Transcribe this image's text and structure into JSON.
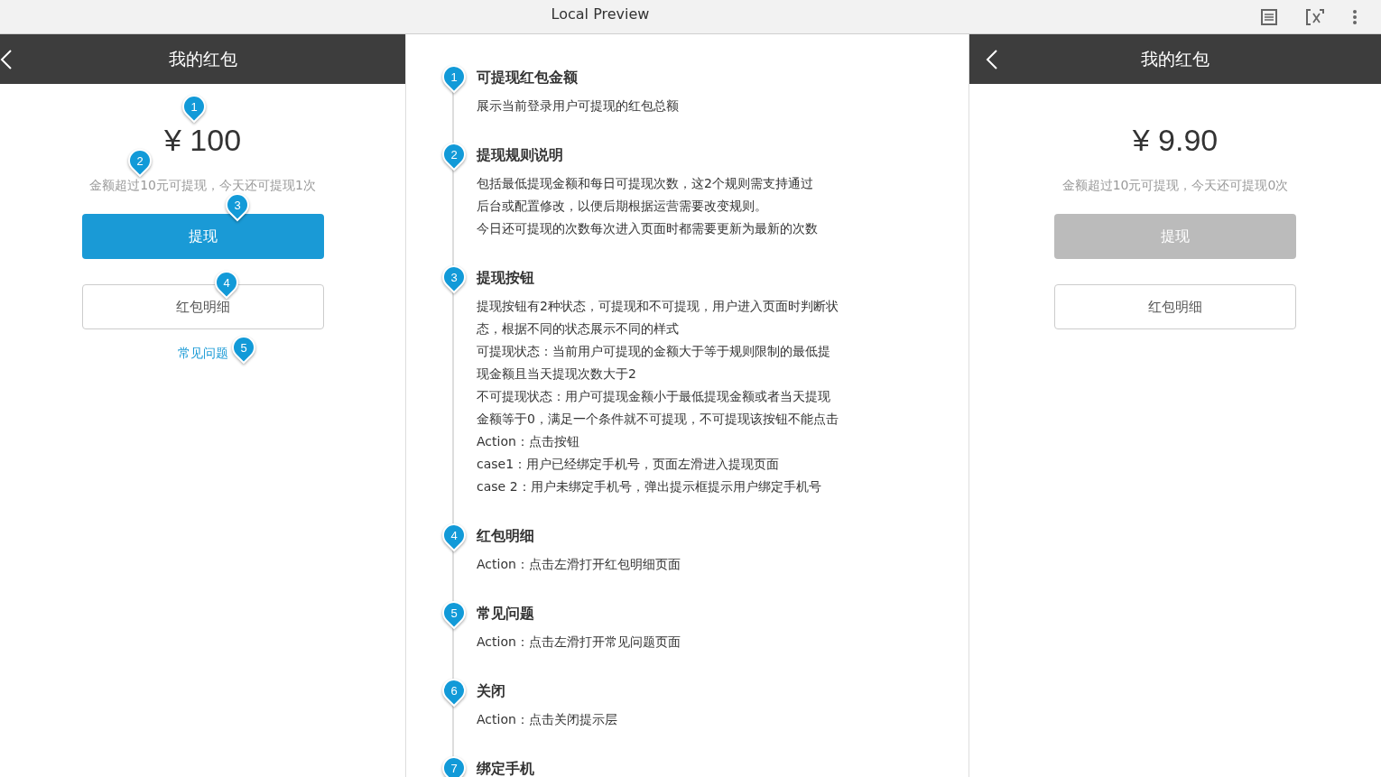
{
  "window": {
    "title": "Local Preview"
  },
  "phones": [
    {
      "title": "我的红包",
      "amount": "¥ 100",
      "hint": "金额超过10元可提现，今天还可提现1次",
      "withdraw_button": {
        "label": "提现",
        "disabled": false
      },
      "detail_button": "红包明细",
      "faq_link": "常见问题",
      "markers": [
        "1",
        "2",
        "3",
        "4",
        "5"
      ]
    },
    {
      "title": "我的红包",
      "amount": "¥ 9.90",
      "hint": "金额超过10元可提现，今天还可提现0次",
      "withdraw_button": {
        "label": "提现",
        "disabled": true
      },
      "detail_button": "红包明细"
    }
  ],
  "notes": [
    {
      "number": "1",
      "title": "可提现红包金额",
      "lines": [
        "展示当前登录用户可提现的红包总额"
      ]
    },
    {
      "number": "2",
      "title": "提现规则说明",
      "lines": [
        "包括最低提现金额和每日可提现次数，这2个规则需支持通过",
        "后台或配置修改，以便后期根据运营需要改变规则。",
        "今日还可提现的次数每次进入页面时都需要更新为最新的次数"
      ]
    },
    {
      "number": "3",
      "title": "提现按钮",
      "lines": [
        "提现按钮有2种状态，可提现和不可提现，用户进入页面时判断状",
        "态，根据不同的状态展示不同的样式",
        "可提现状态：当前用户可提现的金额大于等于规则限制的最低提",
        "现金额且当天提现次数大于2",
        "不可提现状态：用户可提现金额小于最低提现金额或者当天提现",
        "金额等于0，满足一个条件就不可提现，不可提现该按钮不能点击",
        "Action：点击按钮",
        "case1：用户已经绑定手机号，页面左滑进入提现页面",
        "case 2：用户未绑定手机号，弹出提示框提示用户绑定手机号"
      ]
    },
    {
      "number": "4",
      "title": "红包明细",
      "lines": [
        "Action：点击左滑打开红包明细页面"
      ]
    },
    {
      "number": "5",
      "title": "常见问题",
      "lines": [
        "Action：点击左滑打开常见问题页面"
      ]
    },
    {
      "number": "6",
      "title": "关闭",
      "lines": [
        "Action：点击关闭提示层"
      ]
    },
    {
      "number": "7",
      "title": "绑定手机"
    }
  ]
}
